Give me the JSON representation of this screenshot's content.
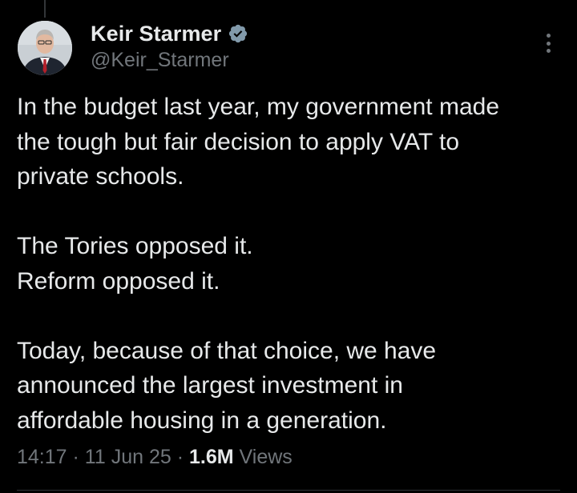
{
  "author": {
    "display_name": "Keir Starmer",
    "handle": "@Keir_Starmer",
    "verified": true,
    "avatar_icon": "profile-photo"
  },
  "tweet": {
    "paragraphs": [
      {
        "lines": [
          "In the budget last year, my government made",
          "the tough but fair decision to apply VAT to",
          "private schools."
        ]
      },
      {
        "lines": [
          "The Tories opposed it.",
          "Reform opposed it."
        ]
      },
      {
        "lines": [
          "Today, because of that choice, we have",
          "announced the largest investment in",
          "affordable housing in a generation."
        ]
      }
    ]
  },
  "meta": {
    "time": "14:17",
    "separator": "·",
    "date": "11 Jun 25",
    "views_count": "1.6M",
    "views_label": "Views"
  },
  "colors": {
    "background": "#000000",
    "text_primary": "#e7e9ea",
    "text_secondary": "#71767b",
    "verified_badge": "#829aab"
  },
  "icons": {
    "verified": "verified-badge-icon",
    "more": "more-options-icon"
  }
}
